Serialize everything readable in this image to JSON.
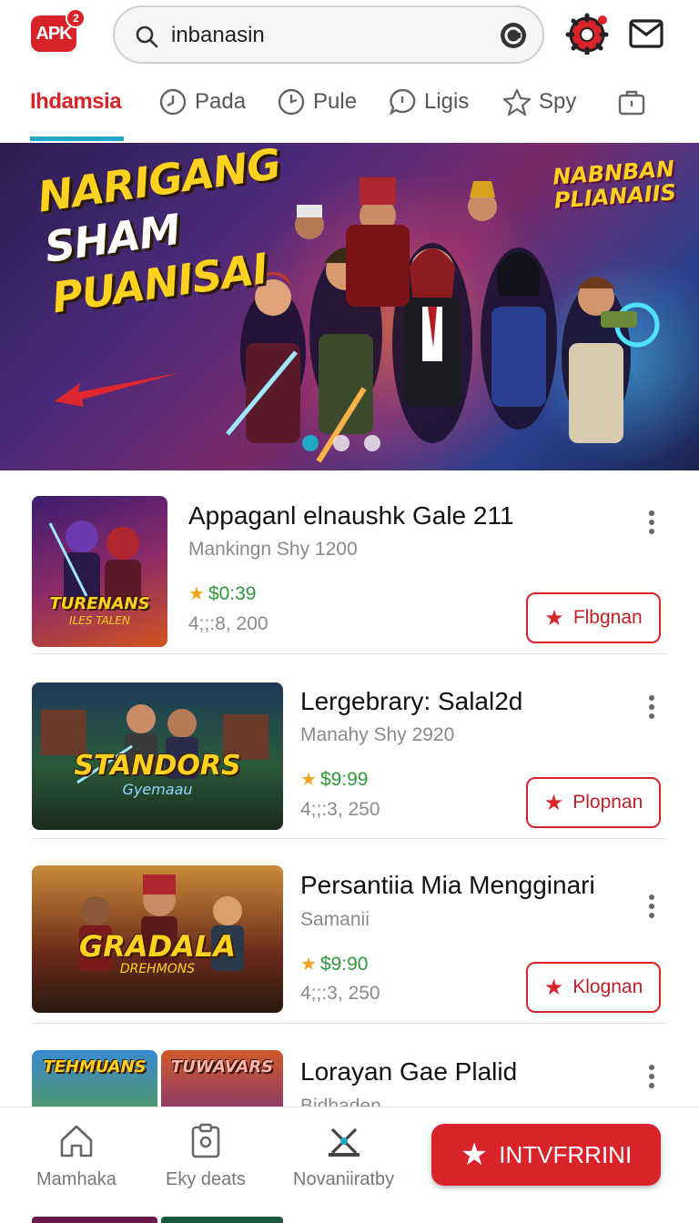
{
  "header": {
    "logo_text": "APK",
    "logo_badge": "2",
    "search": {
      "value": "inbanasin",
      "placeholder": ""
    }
  },
  "tabs": [
    {
      "label": "Ihdamsia",
      "icon": "",
      "active": true
    },
    {
      "label": "Pada",
      "icon": "clock-icon",
      "active": false
    },
    {
      "label": "Pule",
      "icon": "clock-icon",
      "active": false
    },
    {
      "label": "Ligis",
      "icon": "chat-icon",
      "active": false
    },
    {
      "label": "Spy",
      "icon": "star-icon",
      "active": false
    },
    {
      "label": "",
      "icon": "briefcase-icon",
      "active": false
    }
  ],
  "banner": {
    "title_lines": [
      "NARIGANG",
      "SHAM",
      "PUANISAI"
    ],
    "badge_lines": [
      "NABNBAN",
      "PLIANAIIS"
    ],
    "dots": 3,
    "active_dot": 0
  },
  "apps": [
    {
      "title": "Appaganl elnaushk Gale 211",
      "subtitle": "Mankingn Shy 1200",
      "price": "$0:39",
      "meta": "4;;:8, 200",
      "button": "Flbgnan",
      "thumb_text": "TURENANS",
      "thumb_sub": "ILES TALEN"
    },
    {
      "title": "Lergebrary: Salal2d",
      "subtitle": "Manahy Shy 2920",
      "price": "$9:99",
      "meta": "4;;:3, 250",
      "button": "Plopnan",
      "thumb_text": "STANDORS",
      "thumb_sub": "Gyemaau"
    },
    {
      "title": "Persantiia Mia Mengginari",
      "subtitle": "Samanii",
      "price": "$9:90",
      "meta": "4;;:3, 250",
      "button": "Klognan",
      "thumb_text": "GRADALA",
      "thumb_sub": "DREHMONS"
    },
    {
      "title": "Lorayan Gae Plalid",
      "subtitle": "Bidhaden",
      "thumb_text": "TEHMUANS",
      "thumb_text_2": "TUWAVARS"
    }
  ],
  "bottom_nav": [
    {
      "label": "Mamhaka",
      "icon": "home-icon"
    },
    {
      "label": "Eky deats",
      "icon": "clipboard-icon"
    },
    {
      "label": "Novaniiratby",
      "icon": "tools-icon"
    }
  ],
  "cta_label": "INTVFRRINI",
  "colors": {
    "accent": "#d9232a",
    "tab_indicator": "#21a8c9",
    "price": "#2e9a3a"
  }
}
